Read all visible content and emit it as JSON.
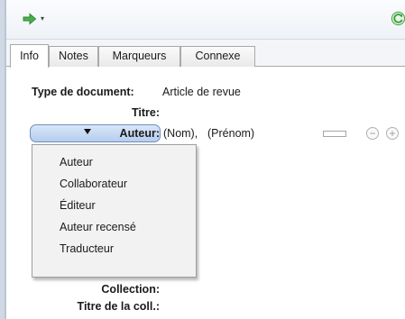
{
  "toolbar": {
    "nav_icon": "green-arrow-icon",
    "nav_caret": "▾",
    "sync_icon": "green-sync-icon",
    "accent_green": "#3aa040"
  },
  "tabs": [
    "Info",
    "Notes",
    "Marqueurs",
    "Connexe"
  ],
  "selected_tab": "Info",
  "fields": {
    "item_type_label": "Type de document:",
    "item_type_value": "Article de revue",
    "title_label": "Titre:",
    "creator_label": "Auteur:",
    "creator_lastname": "(Nom),",
    "creator_firstname": "(Prénom)",
    "series_label": "Collection:",
    "series_title_label": "Titre de la coll.:"
  },
  "creator_buttons": {
    "remove": "−",
    "add": "+"
  },
  "creator_menu": [
    "Auteur",
    "Collaborateur",
    "Éditeur",
    "Auteur recensé",
    "Traducteur"
  ],
  "colors": {
    "creator_button_fill": "#b6cdef",
    "menu_background": "#f2f2f2"
  }
}
